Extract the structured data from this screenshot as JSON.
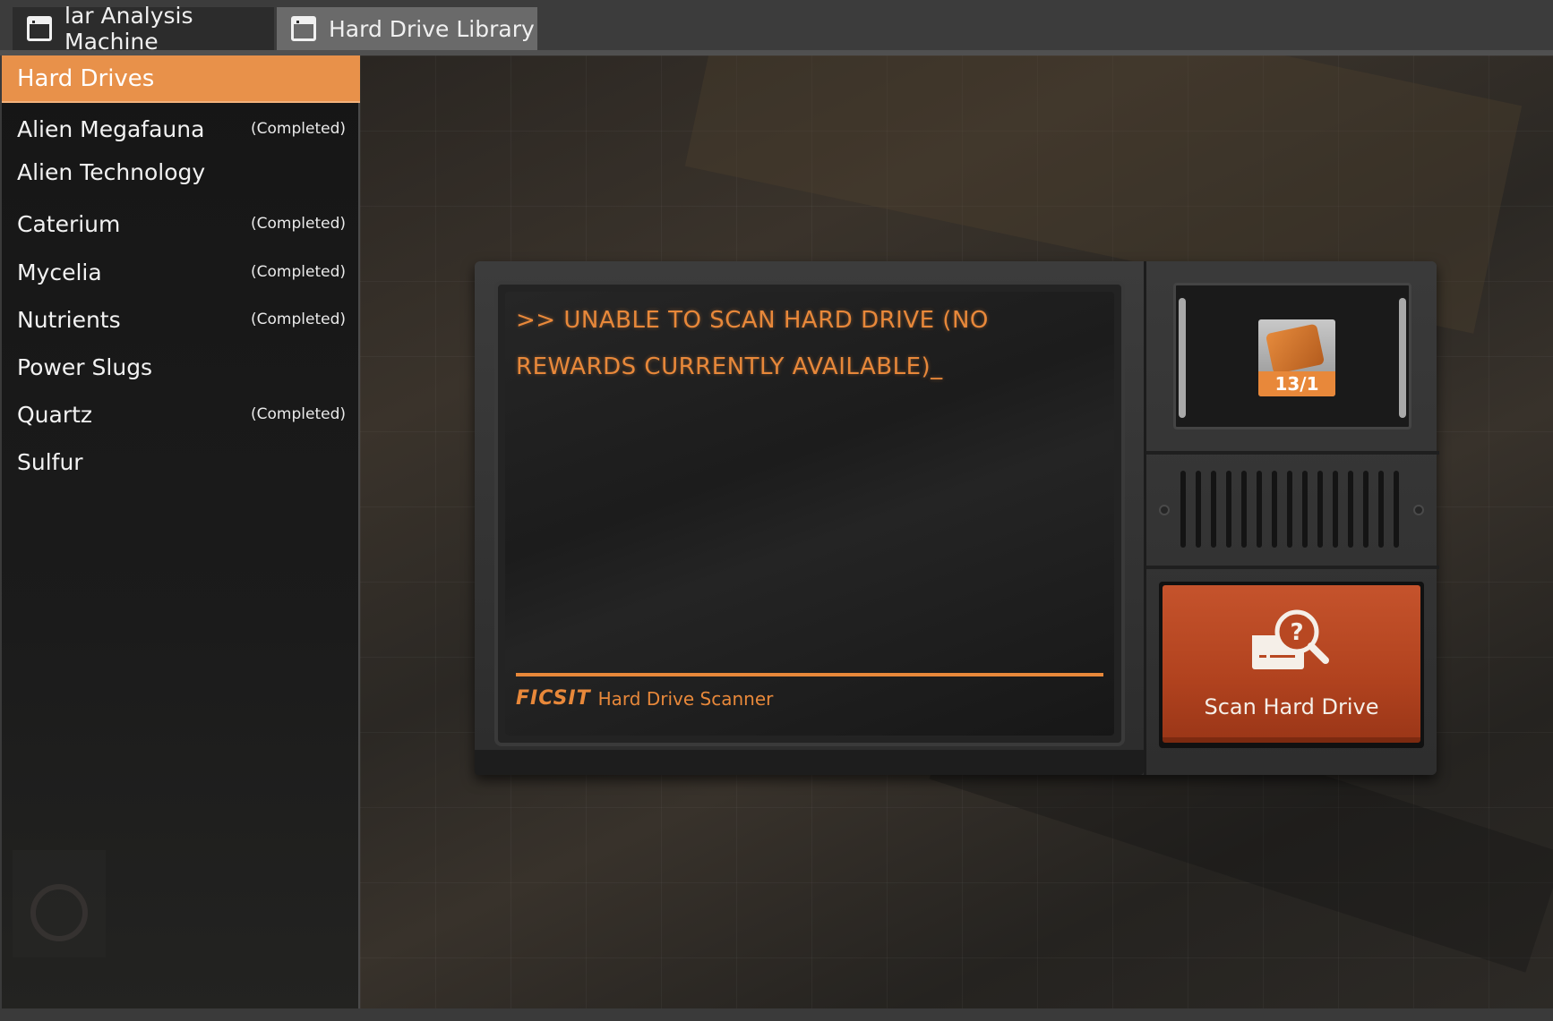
{
  "tabs": [
    {
      "label": "lar Analysis Machine"
    },
    {
      "label": "Hard Drive Library"
    }
  ],
  "sidebar": {
    "header": "Hard Drives",
    "items": [
      {
        "label": "Alien Megafauna",
        "status": "(Completed)"
      },
      {
        "label": "Alien Technology",
        "status": ""
      },
      {
        "label": "Caterium",
        "status": "(Completed)"
      },
      {
        "label": "Mycelia",
        "status": "(Completed)"
      },
      {
        "label": "Nutrients",
        "status": "(Completed)"
      },
      {
        "label": "Power Slugs",
        "status": ""
      },
      {
        "label": "Quartz",
        "status": "(Completed)"
      },
      {
        "label": "Sulfur",
        "status": ""
      }
    ]
  },
  "scanner": {
    "message": ">> UNABLE TO SCAN HARD DRIVE (NO REWARDS CURRENTLY AVAILABLE)_",
    "brand": "FICSIT",
    "footer_label": "Hard Drive Scanner",
    "slot_count": "13/1",
    "scan_button_label": "Scan Hard Drive",
    "accent_color": "#e8883a",
    "button_color": "#b84822"
  }
}
